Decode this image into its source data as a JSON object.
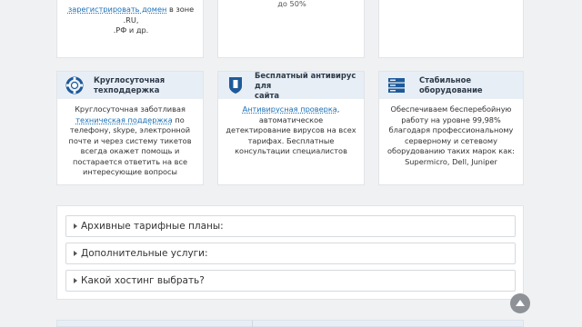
{
  "top_cards": {
    "domains": {
      "link_text": "зарегистрировать домен",
      "text_after": "в зоне .RU,",
      "line2": ".РФ и др."
    },
    "middle_fragment": "до 50%"
  },
  "features": [
    {
      "title_line1": "Круглосуточная",
      "title_line2": "техподдержка",
      "icon": "lifebuoy-icon",
      "text_before": "Круглосуточная заботливая",
      "link_text": "техническая поддержка",
      "text_after": "по телефону, skype, электронной почте и через систему тикетов всегда окажет помощь и постарается ответить на все интересующие вопросы"
    },
    {
      "title_line1": "Бесплатный антивирус для",
      "title_line2": "сайта",
      "icon": "shield-icon",
      "text_before": "",
      "link_text": "Антивирусная проверка",
      "text_after": ", автоматическое детектирование вирусов на всех тарифах. Бесплатные консультации специалистов"
    },
    {
      "title_line1": "Стабильное оборудование",
      "title_line2": "",
      "icon": "server-icon",
      "text_before": "Обеспечиваем бесперебойную работу на уровне 99,98% благодаря профессиональному серверному и сетевому оборудованию таких марок как: Supermicro, Dell, Juniper",
      "link_text": "",
      "text_after": ""
    }
  ],
  "faq": [
    {
      "label": "Архивные тарифные планы:"
    },
    {
      "label": "Дополнительные услуги:"
    },
    {
      "label": "Какой хостинг выбрать?"
    }
  ],
  "colors": {
    "accent": "#1a6fb5",
    "card_head": "#e8eef5",
    "icon": "#1e5a9a"
  }
}
